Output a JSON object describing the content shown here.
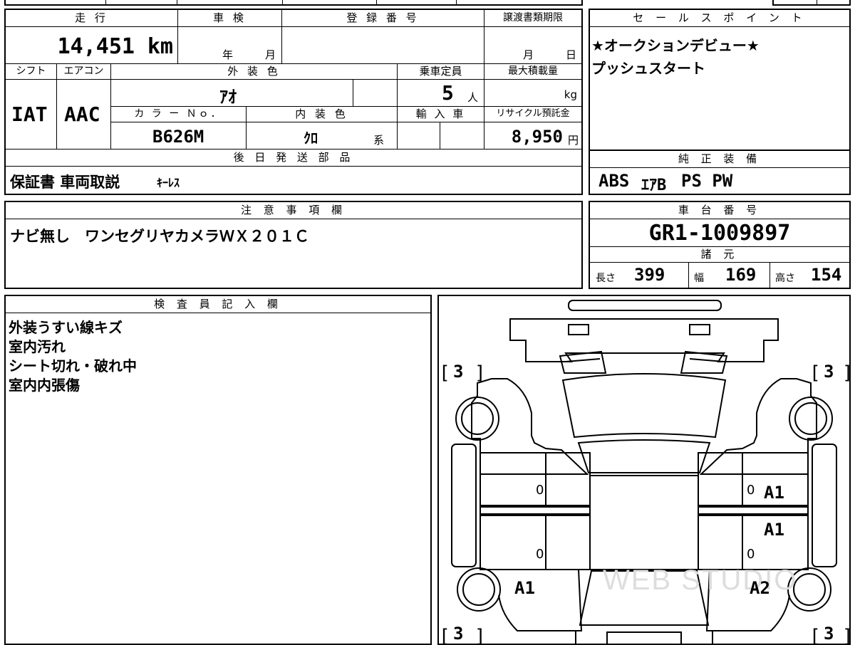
{
  "info": {
    "mileage_label": "走 行",
    "mileage_value": "14,451",
    "mileage_unit": "km",
    "inspection_label": "車 検",
    "year_unit": "年",
    "month_unit": "月",
    "reg_label": "登 録 番 号",
    "transfer_label": "譲渡書類期限",
    "day_unit": "日",
    "shift_label": "シフト",
    "shift_value": "IAT",
    "ac_label": "エアコン",
    "ac_value": "AAC",
    "ext_color_label": "外 装 色",
    "ext_color_value": "ｱｵ",
    "capacity_label": "乗車定員",
    "capacity_value": "5",
    "capacity_unit": "人",
    "max_load_label": "最大積載量",
    "max_load_unit": "kg",
    "color_no_label": "カ ラ ー Ｎｏ．",
    "color_no_value": "B626M",
    "int_color_label": "内 装 色",
    "int_color_value": "ｸﾛ",
    "int_color_suffix": "系",
    "import_label": "輸 入 車",
    "recycle_label": "リサイクル預託金",
    "recycle_value": "8,950",
    "recycle_unit": "円",
    "later_parts_label": "後 日 発 送 部 品",
    "later_parts_value": "保証書 車両取説",
    "later_parts_extra": "ｷｰﾚｽ"
  },
  "sales": {
    "label": "セ ー ル ス ポ イ ン ト",
    "lines": [
      "★オークションデビュー★",
      "プッシュスタート"
    ]
  },
  "equipment": {
    "label": "純 正 装 備",
    "value": "ABS",
    "airbag": "ｴｱB",
    "ps_pw": "PS PW"
  },
  "notes": {
    "label": "注 意 事 項 欄",
    "value": "ナビ無し　ワンセグリヤカメラＷＸ２０１Ｃ"
  },
  "chassis": {
    "label": "車 台 番 号",
    "value": "GR1-1009897",
    "specs_label": "諸 元",
    "length_label": "長さ",
    "length_value": "399",
    "width_label": "幅",
    "width_value": "169",
    "height_label": "高さ",
    "height_value": "154"
  },
  "inspector": {
    "label": "検 査 員 記 入 欄",
    "lines": [
      "外装うすい線キズ",
      "室内汚れ",
      "シート切れ・破れ中",
      "室内内張傷"
    ]
  },
  "diagram": {
    "tire_top_left": "3",
    "tire_top_right": "3",
    "tire_bottom_left": "3",
    "tire_bottom_right": "3",
    "zero_left_front": "0",
    "zero_left_rear": "0",
    "zero_right_front": "0",
    "zero_right_rear": "0",
    "mark_right_front_door": "A1",
    "mark_right_rear_door": "A1",
    "mark_left_rear_fender": "A1",
    "mark_right_rear_fender": "A2",
    "watermark": "WEB STUDIO"
  }
}
